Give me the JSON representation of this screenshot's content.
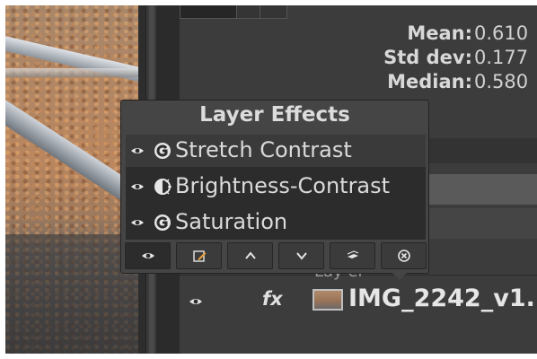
{
  "canvas": {
    "description_free": ""
  },
  "histogram_stats": {
    "mean_label": "Mean:",
    "mean_value": "0.610",
    "stddev_label": "Std dev:",
    "stddev_value": "0.177",
    "median_label": "Median:",
    "median_value": "0.580"
  },
  "layers": {
    "above_name": "Lay er",
    "fx_label": "fx",
    "main_name": "IMG_2242_v1."
  },
  "popup": {
    "title": "Layer Effects",
    "effects": [
      {
        "label": "Stretch Contrast",
        "icon": "gegl-icon",
        "visible": true
      },
      {
        "label": "Brightness-Contrast",
        "icon": "brightness-contrast-icon",
        "visible": true
      },
      {
        "label": "Saturation",
        "icon": "gegl-icon",
        "visible": true
      }
    ],
    "toolbar": [
      {
        "name": "toggle-visibility-button",
        "icon": "eye-icon"
      },
      {
        "name": "edit-effect-button",
        "icon": "edit-icon"
      },
      {
        "name": "raise-effect-button",
        "icon": "chevron-up-icon"
      },
      {
        "name": "lower-effect-button",
        "icon": "chevron-down-icon"
      },
      {
        "name": "merge-effects-button",
        "icon": "merge-layers-icon"
      },
      {
        "name": "remove-effect-button",
        "icon": "remove-icon"
      }
    ]
  },
  "colors": {
    "dock_bg": "#3c3c3c",
    "popup_bg": "#454545",
    "list_bg": "#2c2c2c",
    "text": "#dadada"
  }
}
